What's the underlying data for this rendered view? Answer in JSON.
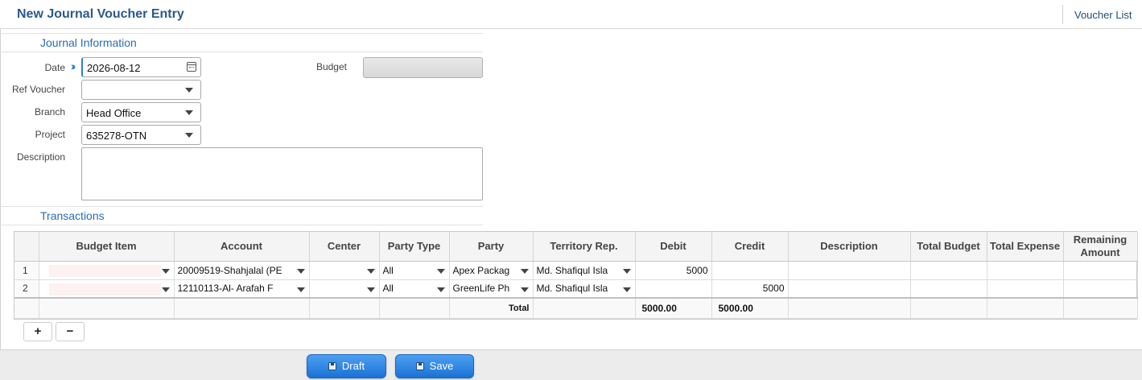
{
  "header": {
    "title": "New Journal Voucher Entry",
    "voucher_list": "Voucher List"
  },
  "journal": {
    "section_title": "Journal Information",
    "date_label": "Date",
    "date_value": "2026-08-12",
    "budget_label": "Budget",
    "budget_value": "",
    "ref_voucher_label": "Ref Voucher",
    "ref_voucher_value": "",
    "branch_label": "Branch",
    "branch_value": "Head Office",
    "project_label": "Project",
    "project_value": "635278-OTN",
    "description_label": "Description",
    "description_value": ""
  },
  "transactions": {
    "section_title": "Transactions",
    "columns": [
      "",
      "Budget Item",
      "Account",
      "Center",
      "Party Type",
      "Party",
      "Territory Rep.",
      "Debit",
      "Credit",
      "Description",
      "Total Budget",
      "Total Expense",
      "Remaining Amount"
    ],
    "rows": [
      {
        "no": "1",
        "budget_item": "",
        "account": "20009519-Shahjalal (PE",
        "center": "",
        "party_type": "All",
        "party": "Apex Packag",
        "territory_rep": "Md. Shafiqul Isla",
        "debit": "5000",
        "credit": "",
        "description": "",
        "total_budget": "",
        "total_expense": "",
        "remaining": ""
      },
      {
        "no": "2",
        "budget_item": "",
        "account": "12110113-Al- Arafah F",
        "center": "",
        "party_type": "All",
        "party": "GreenLife Ph",
        "territory_rep": "Md. Shafiqul Isla",
        "debit": "",
        "credit": "5000",
        "description": "",
        "total_budget": "",
        "total_expense": "",
        "remaining": ""
      }
    ],
    "total_label": "Total",
    "total_debit": "5000.00",
    "total_credit": "5000.00",
    "add_row": "+",
    "remove_row": "−"
  },
  "footer": {
    "draft_label": "Draft",
    "save_label": "Save"
  },
  "colors": {
    "accent": "#2a6db5",
    "title": "#2a5a8c",
    "button": "#1a72d6"
  },
  "icons": {
    "date_nav": "double-chevron-right-icon",
    "calendar": "calendar-icon",
    "dropdown": "chevron-down-icon",
    "save": "floppy-disk-icon"
  }
}
